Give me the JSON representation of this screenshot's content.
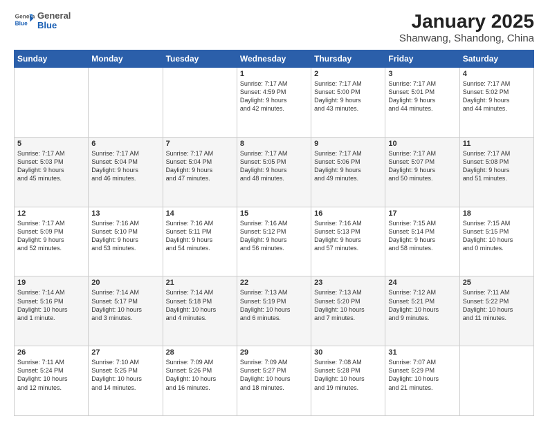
{
  "header": {
    "logo_general": "General",
    "logo_blue": "Blue",
    "title": "January 2025",
    "subtitle": "Shanwang, Shandong, China"
  },
  "weekdays": [
    "Sunday",
    "Monday",
    "Tuesday",
    "Wednesday",
    "Thursday",
    "Friday",
    "Saturday"
  ],
  "weeks": [
    [
      {
        "day": "",
        "info": ""
      },
      {
        "day": "",
        "info": ""
      },
      {
        "day": "",
        "info": ""
      },
      {
        "day": "1",
        "info": "Sunrise: 7:17 AM\nSunset: 4:59 PM\nDaylight: 9 hours\nand 42 minutes."
      },
      {
        "day": "2",
        "info": "Sunrise: 7:17 AM\nSunset: 5:00 PM\nDaylight: 9 hours\nand 43 minutes."
      },
      {
        "day": "3",
        "info": "Sunrise: 7:17 AM\nSunset: 5:01 PM\nDaylight: 9 hours\nand 44 minutes."
      },
      {
        "day": "4",
        "info": "Sunrise: 7:17 AM\nSunset: 5:02 PM\nDaylight: 9 hours\nand 44 minutes."
      }
    ],
    [
      {
        "day": "5",
        "info": "Sunrise: 7:17 AM\nSunset: 5:03 PM\nDaylight: 9 hours\nand 45 minutes."
      },
      {
        "day": "6",
        "info": "Sunrise: 7:17 AM\nSunset: 5:04 PM\nDaylight: 9 hours\nand 46 minutes."
      },
      {
        "day": "7",
        "info": "Sunrise: 7:17 AM\nSunset: 5:04 PM\nDaylight: 9 hours\nand 47 minutes."
      },
      {
        "day": "8",
        "info": "Sunrise: 7:17 AM\nSunset: 5:05 PM\nDaylight: 9 hours\nand 48 minutes."
      },
      {
        "day": "9",
        "info": "Sunrise: 7:17 AM\nSunset: 5:06 PM\nDaylight: 9 hours\nand 49 minutes."
      },
      {
        "day": "10",
        "info": "Sunrise: 7:17 AM\nSunset: 5:07 PM\nDaylight: 9 hours\nand 50 minutes."
      },
      {
        "day": "11",
        "info": "Sunrise: 7:17 AM\nSunset: 5:08 PM\nDaylight: 9 hours\nand 51 minutes."
      }
    ],
    [
      {
        "day": "12",
        "info": "Sunrise: 7:17 AM\nSunset: 5:09 PM\nDaylight: 9 hours\nand 52 minutes."
      },
      {
        "day": "13",
        "info": "Sunrise: 7:16 AM\nSunset: 5:10 PM\nDaylight: 9 hours\nand 53 minutes."
      },
      {
        "day": "14",
        "info": "Sunrise: 7:16 AM\nSunset: 5:11 PM\nDaylight: 9 hours\nand 54 minutes."
      },
      {
        "day": "15",
        "info": "Sunrise: 7:16 AM\nSunset: 5:12 PM\nDaylight: 9 hours\nand 56 minutes."
      },
      {
        "day": "16",
        "info": "Sunrise: 7:16 AM\nSunset: 5:13 PM\nDaylight: 9 hours\nand 57 minutes."
      },
      {
        "day": "17",
        "info": "Sunrise: 7:15 AM\nSunset: 5:14 PM\nDaylight: 9 hours\nand 58 minutes."
      },
      {
        "day": "18",
        "info": "Sunrise: 7:15 AM\nSunset: 5:15 PM\nDaylight: 10 hours\nand 0 minutes."
      }
    ],
    [
      {
        "day": "19",
        "info": "Sunrise: 7:14 AM\nSunset: 5:16 PM\nDaylight: 10 hours\nand 1 minute."
      },
      {
        "day": "20",
        "info": "Sunrise: 7:14 AM\nSunset: 5:17 PM\nDaylight: 10 hours\nand 3 minutes."
      },
      {
        "day": "21",
        "info": "Sunrise: 7:14 AM\nSunset: 5:18 PM\nDaylight: 10 hours\nand 4 minutes."
      },
      {
        "day": "22",
        "info": "Sunrise: 7:13 AM\nSunset: 5:19 PM\nDaylight: 10 hours\nand 6 minutes."
      },
      {
        "day": "23",
        "info": "Sunrise: 7:13 AM\nSunset: 5:20 PM\nDaylight: 10 hours\nand 7 minutes."
      },
      {
        "day": "24",
        "info": "Sunrise: 7:12 AM\nSunset: 5:21 PM\nDaylight: 10 hours\nand 9 minutes."
      },
      {
        "day": "25",
        "info": "Sunrise: 7:11 AM\nSunset: 5:22 PM\nDaylight: 10 hours\nand 11 minutes."
      }
    ],
    [
      {
        "day": "26",
        "info": "Sunrise: 7:11 AM\nSunset: 5:24 PM\nDaylight: 10 hours\nand 12 minutes."
      },
      {
        "day": "27",
        "info": "Sunrise: 7:10 AM\nSunset: 5:25 PM\nDaylight: 10 hours\nand 14 minutes."
      },
      {
        "day": "28",
        "info": "Sunrise: 7:09 AM\nSunset: 5:26 PM\nDaylight: 10 hours\nand 16 minutes."
      },
      {
        "day": "29",
        "info": "Sunrise: 7:09 AM\nSunset: 5:27 PM\nDaylight: 10 hours\nand 18 minutes."
      },
      {
        "day": "30",
        "info": "Sunrise: 7:08 AM\nSunset: 5:28 PM\nDaylight: 10 hours\nand 19 minutes."
      },
      {
        "day": "31",
        "info": "Sunrise: 7:07 AM\nSunset: 5:29 PM\nDaylight: 10 hours\nand 21 minutes."
      },
      {
        "day": "",
        "info": ""
      }
    ]
  ]
}
